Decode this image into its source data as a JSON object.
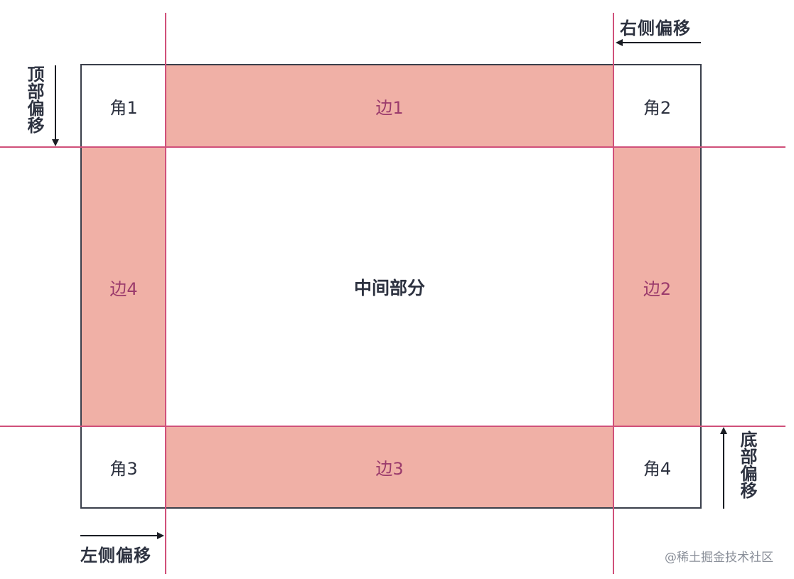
{
  "corners": {
    "corner1": "角1",
    "corner2": "角2",
    "corner3": "角3",
    "corner4": "角4"
  },
  "edges": {
    "edge1": "边1",
    "edge2": "边2",
    "edge3": "边3",
    "edge4": "边4"
  },
  "center_label": "中间部分",
  "offsets": {
    "top": "顶部偏移",
    "right": "右侧偏移",
    "bottom": "底部偏移",
    "left": "左侧偏移"
  },
  "watermark": "@稀土掘金技术社区",
  "colors": {
    "edge_fill": "#f0b0a6",
    "guide_line": "#d0507a",
    "frame_border": "#3a3f4b",
    "edge_text": "#9b3b6c",
    "dark_text": "#2d3240"
  }
}
